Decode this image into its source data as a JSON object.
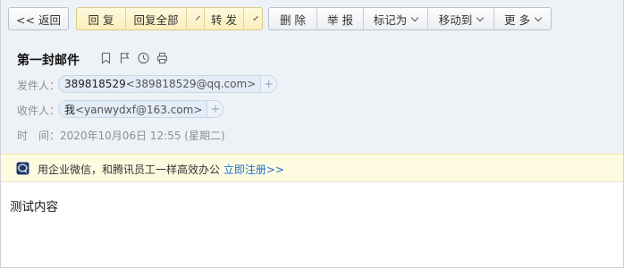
{
  "toolbar": {
    "back_label": "<< 返回",
    "reply_label": "回 复",
    "reply_all_label": "回复全部",
    "forward_label": "转 发",
    "delete_label": "删 除",
    "report_label": "举 报",
    "mark_as_label": "标记为",
    "move_to_label": "移动到",
    "more_label": "更 多"
  },
  "email": {
    "subject": "第一封邮件",
    "from_label": "发件人：",
    "from_name": "389818529",
    "from_address": "<389818529@qq.com>",
    "to_label": "收件人：",
    "to_name": "我",
    "to_address": "<yanwydxf@163.com>",
    "time_label": "时　间：",
    "time_value": "2020年10月06日 12:55 (星期二)",
    "body": "测试内容"
  },
  "banner": {
    "text": "用企业微信，和腾讯员工一样高效办公",
    "link": "立即注册>>"
  },
  "colors": {
    "header_bg": "#eef2f7",
    "banner_bg": "#fffbe0",
    "link": "#1a6fd1",
    "chip_bg": "#e3ecf7"
  }
}
